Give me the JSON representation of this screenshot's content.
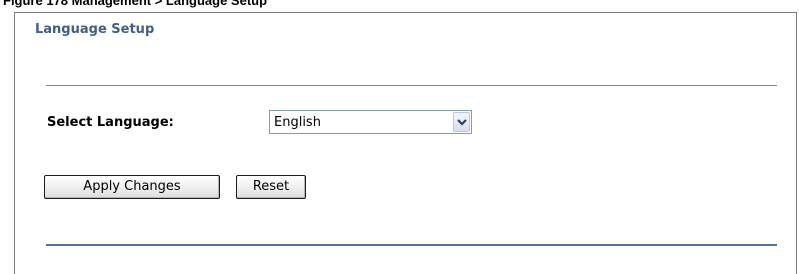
{
  "caption": "Figure 178 Management > Language Setup",
  "section": {
    "title": "Language Setup"
  },
  "form": {
    "language_label": "Select Language:",
    "language_value": "English"
  },
  "actions": {
    "apply_label": "Apply Changes",
    "reset_label": "Reset"
  },
  "icons": {
    "dropdown": "chevron-down-icon"
  },
  "colors": {
    "title": "#3f5f86",
    "rule": "#52739c"
  }
}
